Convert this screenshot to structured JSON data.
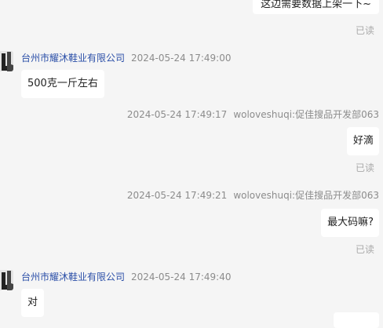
{
  "messages": [
    {
      "text": "这边需要数据上架一下~",
      "read": "已读"
    },
    {
      "sender": "台州市耀沐鞋业有限公司",
      "time": "2024-05-24 17:49:00",
      "text": "500克一斤左右"
    },
    {
      "time": "2024-05-24 17:49:17",
      "sender": "woloveshuqi:促佳搜品开发部063",
      "text": "好滴",
      "read": "已读"
    },
    {
      "time": "2024-05-24 17:49:21",
      "sender": "woloveshuqi:促佳搜品开发部063",
      "text": "最大码嘛?",
      "read": "已读"
    },
    {
      "sender": "台州市耀沐鞋业有限公司",
      "time": "2024-05-24 17:49:40",
      "text": "对"
    }
  ]
}
